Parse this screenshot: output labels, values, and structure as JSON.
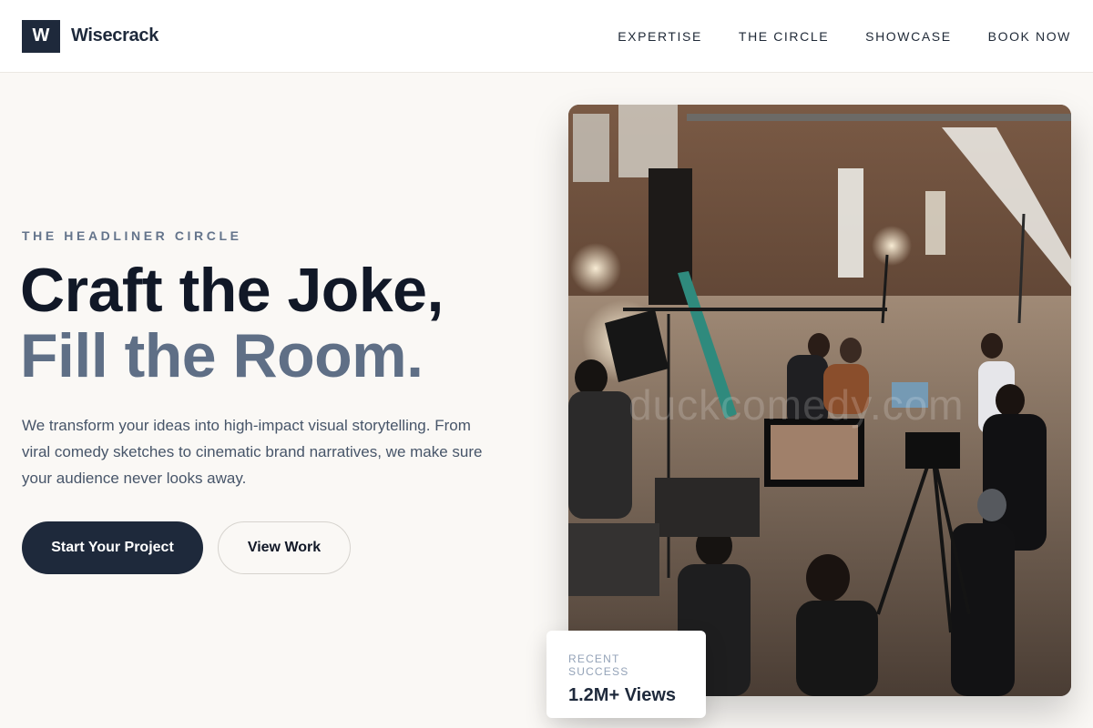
{
  "brand": {
    "logo_letter": "W",
    "name": "Wisecrack"
  },
  "nav": {
    "items": [
      {
        "label": "EXPERTISE"
      },
      {
        "label": "THE CIRCLE"
      },
      {
        "label": "SHOWCASE"
      },
      {
        "label": "BOOK NOW"
      }
    ]
  },
  "hero": {
    "eyebrow": "THE HEADLINER CIRCLE",
    "headline_line1": "Craft the Joke,",
    "headline_line2": "Fill the Room.",
    "description": "We transform your ideas into high-impact visual storytelling. From viral comedy sketches to cinematic brand narratives, we make sure your audience never looks away.",
    "primary_cta": "Start Your Project",
    "secondary_cta": "View Work",
    "image_watermark": "duckcomedy.com"
  },
  "stat": {
    "label": "RECENT SUCCESS",
    "value": "1.2M+ Views"
  },
  "colors": {
    "primary": "#1e293b",
    "accent_muted": "#5f6f86",
    "background": "#faf8f5"
  }
}
